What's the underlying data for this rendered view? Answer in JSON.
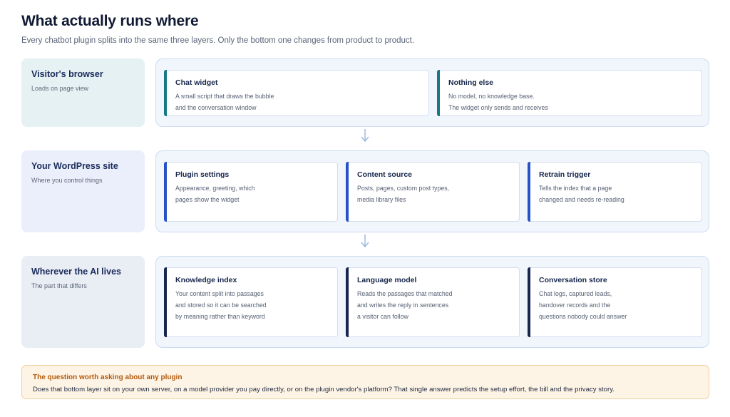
{
  "header": {
    "title": "What actually runs where",
    "subtitle": "Every chatbot plugin splits into the same three layers. Only the bottom one changes from product to product."
  },
  "layers": [
    {
      "label": "Visitor's browser",
      "sublabel": "Loads on page view",
      "label_bg": "#e6f1f3",
      "accent": "#187886",
      "cards": [
        {
          "title": "Chat widget",
          "lines": [
            "A small script that draws the bubble",
            "and the conversation window"
          ]
        },
        {
          "title": "Nothing else",
          "lines": [
            "No model, no knowledge base.",
            "The widget only sends and receives"
          ]
        }
      ]
    },
    {
      "label": "Your WordPress site",
      "sublabel": "Where you control things",
      "label_bg": "#eaeffb",
      "accent": "#2751c7",
      "cards": [
        {
          "title": "Plugin settings",
          "lines": [
            "Appearance, greeting, which",
            "pages show the widget"
          ]
        },
        {
          "title": "Content source",
          "lines": [
            "Posts, pages, custom post types,",
            "media library files"
          ]
        },
        {
          "title": "Retrain trigger",
          "lines": [
            "Tells the index that a page",
            "changed and needs re-reading"
          ]
        }
      ]
    },
    {
      "label": "Wherever the AI lives",
      "sublabel": "The part that differs",
      "label_bg": "#e9edf4",
      "accent": "#17254f",
      "cards": [
        {
          "title": "Knowledge index",
          "lines": [
            "Your content split into passages",
            "and stored so it can be searched",
            "by meaning rather than keyword"
          ]
        },
        {
          "title": "Language model",
          "lines": [
            "Reads the passages that matched",
            "and writes the reply in sentences",
            "a visitor can follow"
          ]
        },
        {
          "title": "Conversation store",
          "lines": [
            "Chat logs, captured leads,",
            "handover records and the",
            "questions nobody could answer"
          ]
        }
      ]
    }
  ],
  "callout": {
    "title": "The question worth asking about any plugin",
    "body": "Does that bottom layer sit on your own server, on a model provider you pay directly, or on the plugin vendor's platform? That single answer predicts the setup effort, the bill and the privacy story."
  }
}
